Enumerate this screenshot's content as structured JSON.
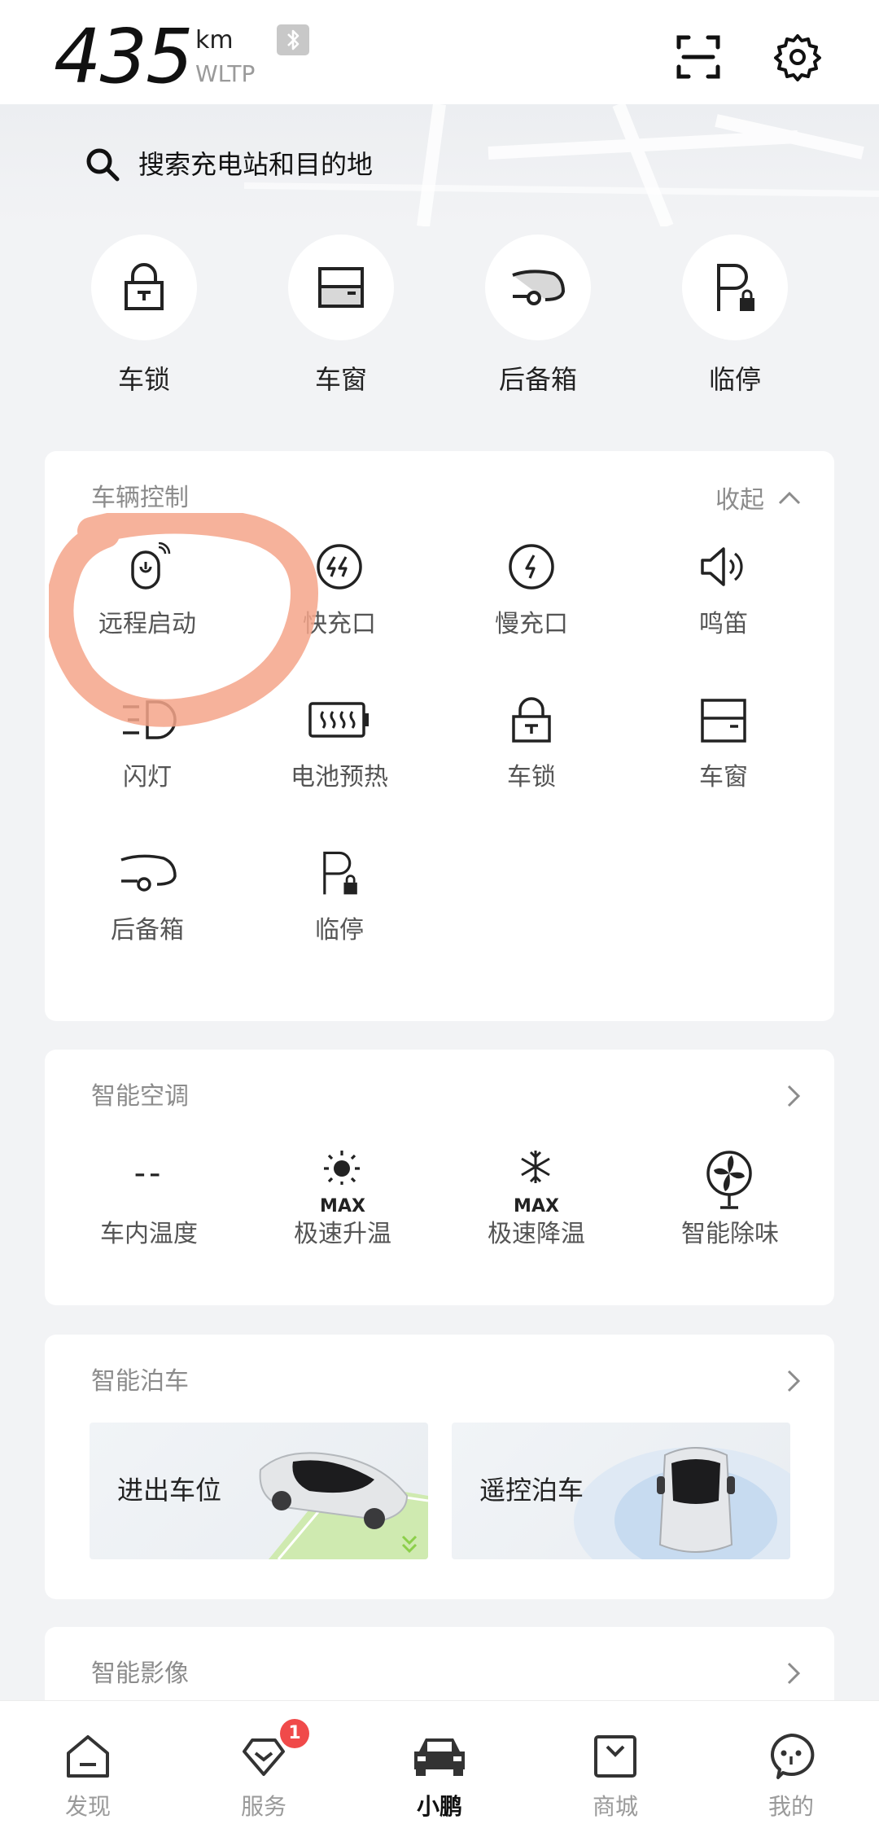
{
  "header": {
    "range_value": "435",
    "range_unit": "km",
    "range_standard": "WLTP",
    "bluetooth_icon": "bluetooth-icon",
    "scan_icon": "scan-icon",
    "settings_icon": "gear-icon"
  },
  "search": {
    "placeholder": "搜索充电站和目的地",
    "icon": "search-icon"
  },
  "quick_actions": [
    {
      "label": "车锁",
      "icon": "lock-icon"
    },
    {
      "label": "车窗",
      "icon": "window-icon"
    },
    {
      "label": "后备箱",
      "icon": "trunk-icon"
    },
    {
      "label": "临停",
      "icon": "parking-lock-icon"
    }
  ],
  "vehicle_control": {
    "title": "车辆控制",
    "collapse_label": "收起",
    "items": [
      {
        "label": "远程启动",
        "icon": "remote-start-icon"
      },
      {
        "label": "快充口",
        "icon": "fast-charge-port-icon"
      },
      {
        "label": "慢充口",
        "icon": "slow-charge-port-icon"
      },
      {
        "label": "鸣笛",
        "icon": "horn-icon"
      },
      {
        "label": "闪灯",
        "icon": "flash-lights-icon"
      },
      {
        "label": "电池预热",
        "icon": "battery-preheat-icon"
      },
      {
        "label": "车锁",
        "icon": "lock-icon"
      },
      {
        "label": "车窗",
        "icon": "window-icon"
      },
      {
        "label": "后备箱",
        "icon": "trunk-icon"
      },
      {
        "label": "临停",
        "icon": "parking-lock-icon"
      }
    ]
  },
  "climate": {
    "title": "智能空调",
    "items": [
      {
        "label": "车内温度",
        "value": "--",
        "icon": "temperature-placeholder"
      },
      {
        "label": "极速升温",
        "badge": "MAX",
        "icon": "sun-max-icon"
      },
      {
        "label": "极速降温",
        "badge": "MAX",
        "icon": "snowflake-max-icon"
      },
      {
        "label": "智能除味",
        "icon": "fan-icon"
      }
    ]
  },
  "parking": {
    "title": "智能泊车",
    "items": [
      {
        "label": "进出车位",
        "icon": "car-parking-image"
      },
      {
        "label": "遥控泊车",
        "icon": "car-remote-image"
      }
    ]
  },
  "camera": {
    "title": "智能影像"
  },
  "bottom_nav": [
    {
      "label": "发现",
      "icon": "home-icon",
      "active": false
    },
    {
      "label": "服务",
      "icon": "service-icon",
      "active": false,
      "badge": "1"
    },
    {
      "label": "小鹏",
      "icon": "car-icon",
      "active": true
    },
    {
      "label": "商城",
      "icon": "shop-bag-icon",
      "active": false
    },
    {
      "label": "我的",
      "icon": "profile-icon",
      "active": false
    }
  ],
  "colors": {
    "background": "#f2f3f5",
    "card": "#ffffff",
    "annotation": "#f4a58a",
    "badge": "#f04a4a",
    "muted_text": "#8c8c8c"
  }
}
